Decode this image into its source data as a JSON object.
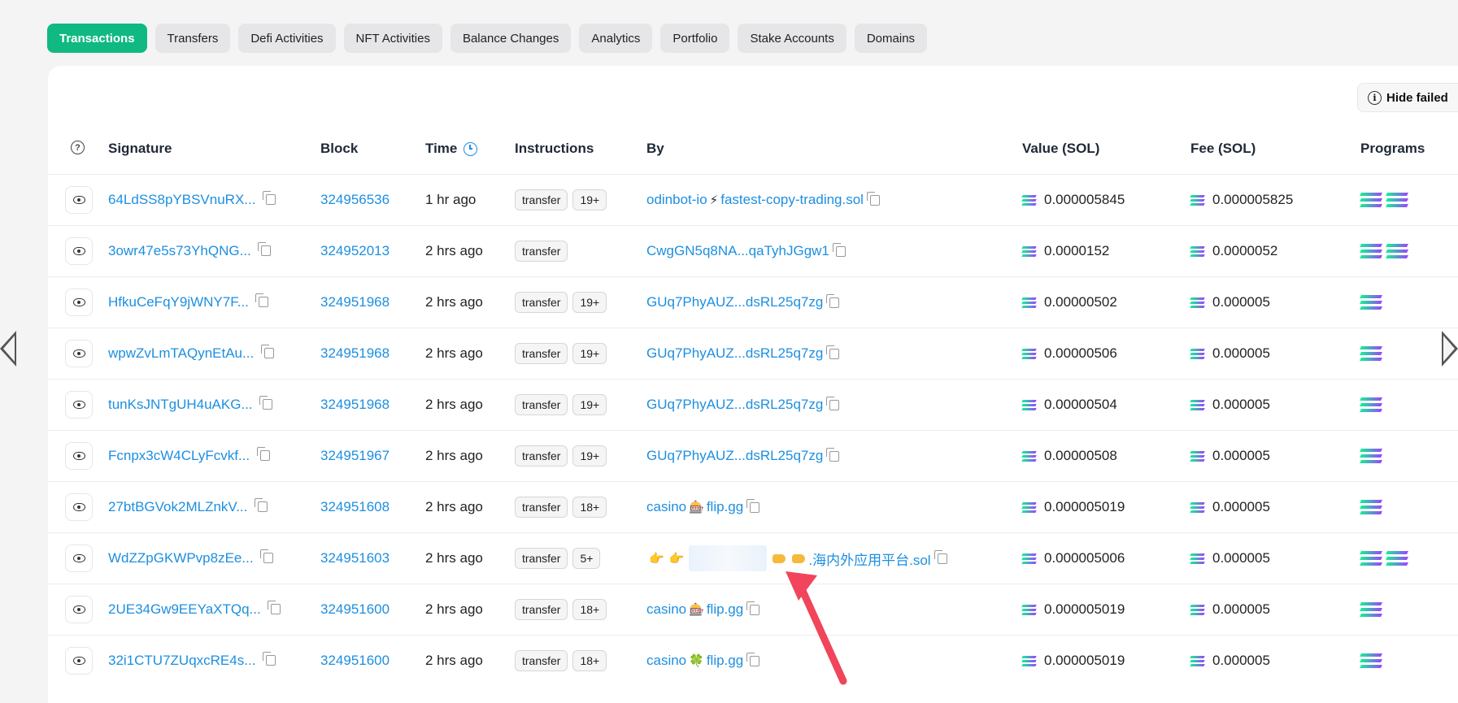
{
  "tabs": [
    "Transactions",
    "Transfers",
    "Defi Activities",
    "NFT Activities",
    "Balance Changes",
    "Analytics",
    "Portfolio",
    "Stake Accounts",
    "Domains"
  ],
  "hide_failed_label": "Hide failed",
  "columns": {
    "signature": "Signature",
    "block": "Block",
    "time": "Time",
    "instructions": "Instructions",
    "by": "By",
    "value": "Value (SOL)",
    "fee": "Fee (SOL)",
    "programs": "Programs"
  },
  "rows": [
    {
      "signature": "64LdSS8pYBSVnuRX...",
      "block": "324956536",
      "time": "1 hr ago",
      "instruction": "transfer",
      "more": "19+",
      "by_left": "odinbot-io",
      "by_mid": "⚡",
      "by_right": "fastest-copy-trading.sol",
      "value": "0.000005845",
      "fee": "0.000005825",
      "programs": 2
    },
    {
      "signature": "3owr47e5s73YhQNG...",
      "block": "324952013",
      "time": "2 hrs ago",
      "instruction": "transfer",
      "more": "",
      "by_left": "CwgGN5q8NA...qaTyhJGgw1",
      "by_mid": "",
      "by_right": "",
      "value": "0.0000152",
      "fee": "0.0000052",
      "programs": 2
    },
    {
      "signature": "HfkuCeFqY9jWNY7F...",
      "block": "324951968",
      "time": "2 hrs ago",
      "instruction": "transfer",
      "more": "19+",
      "by_left": "GUq7PhyAUZ...dsRL25q7zg",
      "by_mid": "",
      "by_right": "",
      "value": "0.00000502",
      "fee": "0.000005",
      "programs": 1
    },
    {
      "signature": "wpwZvLmTAQynEtAu...",
      "block": "324951968",
      "time": "2 hrs ago",
      "instruction": "transfer",
      "more": "19+",
      "by_left": "GUq7PhyAUZ...dsRL25q7zg",
      "by_mid": "",
      "by_right": "",
      "value": "0.00000506",
      "fee": "0.000005",
      "programs": 1
    },
    {
      "signature": "tunKsJNTgUH4uAKG...",
      "block": "324951968",
      "time": "2 hrs ago",
      "instruction": "transfer",
      "more": "19+",
      "by_left": "GUq7PhyAUZ...dsRL25q7zg",
      "by_mid": "",
      "by_right": "",
      "value": "0.00000504",
      "fee": "0.000005",
      "programs": 1
    },
    {
      "signature": "Fcnpx3cW4CLyFcvkf...",
      "block": "324951967",
      "time": "2 hrs ago",
      "instruction": "transfer",
      "more": "19+",
      "by_left": "GUq7PhyAUZ...dsRL25q7zg",
      "by_mid": "",
      "by_right": "",
      "value": "0.00000508",
      "fee": "0.000005",
      "programs": 1
    },
    {
      "signature": "27btBGVok2MLZnkV...",
      "block": "324951608",
      "time": "2 hrs ago",
      "instruction": "transfer",
      "more": "18+",
      "by_left": "casino",
      "by_mid": "🎰",
      "by_right": "flip.gg",
      "value": "0.000005019",
      "fee": "0.000005",
      "programs": 1
    },
    {
      "signature": "WdZZpGKWPvp8zEe...",
      "block": "324951603",
      "time": "2 hrs ago",
      "instruction": "transfer",
      "more": "5+",
      "by_left": "",
      "by_mid": "",
      "by_right": ".海内外应用平台.sol",
      "value": "0.000005006",
      "fee": "0.000005",
      "programs": 2
    },
    {
      "signature": "2UE34Gw9EEYaXTQq...",
      "block": "324951600",
      "time": "2 hrs ago",
      "instruction": "transfer",
      "more": "18+",
      "by_left": "casino",
      "by_mid": "🎰",
      "by_right": "flip.gg",
      "value": "0.000005019",
      "fee": "0.000005",
      "programs": 1
    },
    {
      "signature": "32i1CTU7ZUqxcRE4s...",
      "block": "324951600",
      "time": "2 hrs ago",
      "instruction": "transfer",
      "more": "18+",
      "by_left": "casino",
      "by_mid": "🍀",
      "by_right": "flip.gg",
      "value": "0.000005019",
      "fee": "0.000005",
      "programs": 1
    }
  ],
  "colors": {
    "accent": "#10b981",
    "link": "#1d8fe0",
    "annotation_arrow": "#f0455a"
  }
}
